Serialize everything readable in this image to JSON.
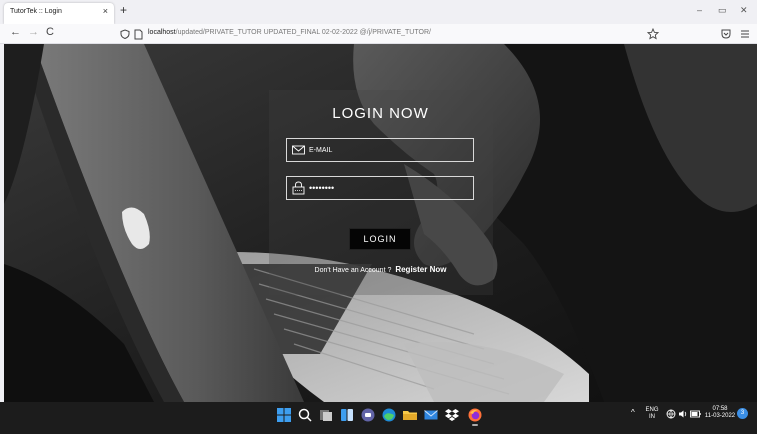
{
  "browser": {
    "tab_title": "TutorTek :: Login",
    "tab_close": "×",
    "new_tab": "+",
    "url_host": "localhost",
    "url_path": "/updated/PRIVATE_TUTOR UPDATED_FINAL 02-02-2022 @/j/PRIVATE_TUTOR/",
    "window_buttons": [
      "–",
      "▭",
      "✕"
    ],
    "nav_back": "←",
    "nav_forward": "→",
    "nav_reload": "C"
  },
  "login": {
    "title": "LOGIN NOW",
    "email_placeholder": "E-MAIL",
    "password_mask": "••••••••",
    "button_label": "LOGIN",
    "register_prompt": "Don't Have an Account ?",
    "register_link": "Register Now"
  },
  "taskbar": {
    "lang_top": "ENG",
    "lang_bottom": "IN",
    "time": "07:58",
    "date": "11-03-2022",
    "notification_count": "3",
    "icons": [
      "windows-start-icon",
      "search-icon",
      "task-view-icon",
      "widgets-icon",
      "teams-chat-icon",
      "edge-browser-icon",
      "file-explorer-icon",
      "mail-icon",
      "dropbox-icon",
      "firefox-icon"
    ]
  },
  "colors": {
    "page_bg": "#1a1a1a",
    "field_border": "#d9d9d9",
    "button_bg": "#050505",
    "taskbar_bg": "#1c1c1c"
  }
}
